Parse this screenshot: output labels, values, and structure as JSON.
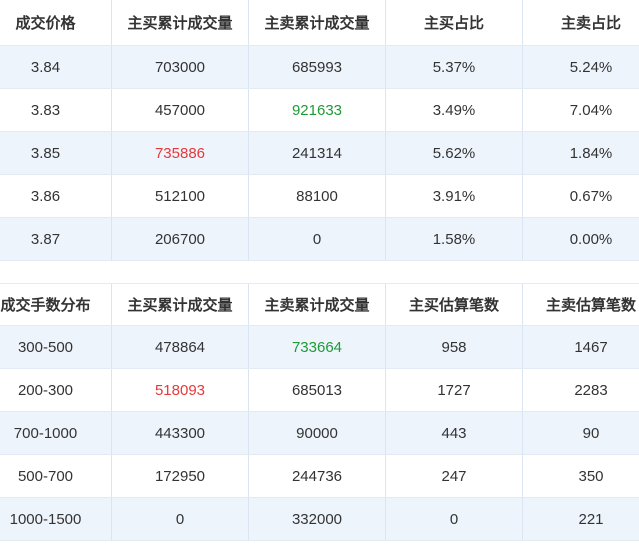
{
  "colors": {
    "buy_max_text": "#e5393a",
    "sell_max_text": "#1e9a37",
    "row_stripe": "#eef4fc",
    "text": "#333333"
  },
  "price_table": {
    "headers": [
      "成交价格",
      "主买累计成交量",
      "主卖累计成交量",
      "主买占比",
      "主卖占比"
    ],
    "rows": [
      [
        "3.84",
        "703000",
        "685993",
        "5.37%",
        "5.24%"
      ],
      [
        "3.83",
        "457000",
        "921633",
        "3.49%",
        "7.04%"
      ],
      [
        "3.85",
        "735886",
        "241314",
        "5.62%",
        "1.84%"
      ],
      [
        "3.86",
        "512100",
        "88100",
        "3.91%",
        "0.67%"
      ],
      [
        "3.87",
        "206700",
        "0",
        "1.58%",
        "0.00%"
      ]
    ]
  },
  "lot_table": {
    "headers": [
      "成交手数分布",
      "主买累计成交量",
      "主卖累计成交量",
      "主买估算笔数",
      "主卖估算笔数"
    ],
    "rows": [
      [
        "300-500",
        "478864",
        "733664",
        "958",
        "1467"
      ],
      [
        "200-300",
        "518093",
        "685013",
        "1727",
        "2283"
      ],
      [
        "700-1000",
        "443300",
        "90000",
        "443",
        "90"
      ],
      [
        "500-700",
        "172950",
        "244736",
        "247",
        "350"
      ],
      [
        "1000-1500",
        "0",
        "332000",
        "0",
        "221"
      ]
    ]
  }
}
